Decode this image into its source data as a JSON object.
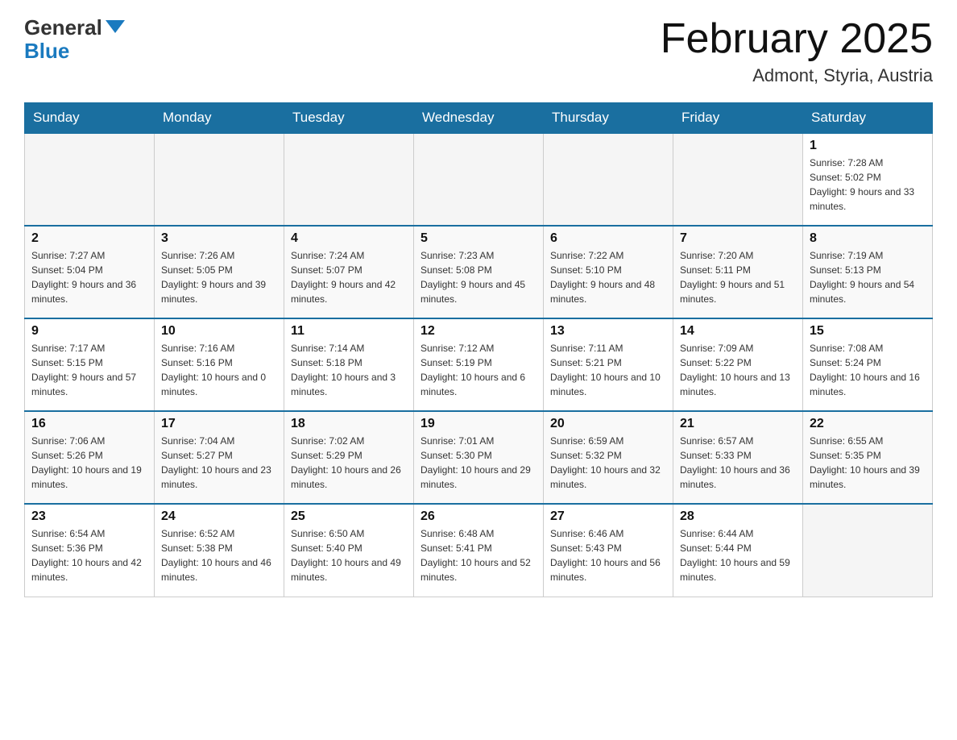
{
  "logo": {
    "text_general": "General",
    "text_blue": "Blue"
  },
  "header": {
    "title": "February 2025",
    "location": "Admont, Styria, Austria"
  },
  "days_of_week": [
    "Sunday",
    "Monday",
    "Tuesday",
    "Wednesday",
    "Thursday",
    "Friday",
    "Saturday"
  ],
  "weeks": [
    [
      {
        "day": "",
        "info": ""
      },
      {
        "day": "",
        "info": ""
      },
      {
        "day": "",
        "info": ""
      },
      {
        "day": "",
        "info": ""
      },
      {
        "day": "",
        "info": ""
      },
      {
        "day": "",
        "info": ""
      },
      {
        "day": "1",
        "info": "Sunrise: 7:28 AM\nSunset: 5:02 PM\nDaylight: 9 hours and 33 minutes."
      }
    ],
    [
      {
        "day": "2",
        "info": "Sunrise: 7:27 AM\nSunset: 5:04 PM\nDaylight: 9 hours and 36 minutes."
      },
      {
        "day": "3",
        "info": "Sunrise: 7:26 AM\nSunset: 5:05 PM\nDaylight: 9 hours and 39 minutes."
      },
      {
        "day": "4",
        "info": "Sunrise: 7:24 AM\nSunset: 5:07 PM\nDaylight: 9 hours and 42 minutes."
      },
      {
        "day": "5",
        "info": "Sunrise: 7:23 AM\nSunset: 5:08 PM\nDaylight: 9 hours and 45 minutes."
      },
      {
        "day": "6",
        "info": "Sunrise: 7:22 AM\nSunset: 5:10 PM\nDaylight: 9 hours and 48 minutes."
      },
      {
        "day": "7",
        "info": "Sunrise: 7:20 AM\nSunset: 5:11 PM\nDaylight: 9 hours and 51 minutes."
      },
      {
        "day": "8",
        "info": "Sunrise: 7:19 AM\nSunset: 5:13 PM\nDaylight: 9 hours and 54 minutes."
      }
    ],
    [
      {
        "day": "9",
        "info": "Sunrise: 7:17 AM\nSunset: 5:15 PM\nDaylight: 9 hours and 57 minutes."
      },
      {
        "day": "10",
        "info": "Sunrise: 7:16 AM\nSunset: 5:16 PM\nDaylight: 10 hours and 0 minutes."
      },
      {
        "day": "11",
        "info": "Sunrise: 7:14 AM\nSunset: 5:18 PM\nDaylight: 10 hours and 3 minutes."
      },
      {
        "day": "12",
        "info": "Sunrise: 7:12 AM\nSunset: 5:19 PM\nDaylight: 10 hours and 6 minutes."
      },
      {
        "day": "13",
        "info": "Sunrise: 7:11 AM\nSunset: 5:21 PM\nDaylight: 10 hours and 10 minutes."
      },
      {
        "day": "14",
        "info": "Sunrise: 7:09 AM\nSunset: 5:22 PM\nDaylight: 10 hours and 13 minutes."
      },
      {
        "day": "15",
        "info": "Sunrise: 7:08 AM\nSunset: 5:24 PM\nDaylight: 10 hours and 16 minutes."
      }
    ],
    [
      {
        "day": "16",
        "info": "Sunrise: 7:06 AM\nSunset: 5:26 PM\nDaylight: 10 hours and 19 minutes."
      },
      {
        "day": "17",
        "info": "Sunrise: 7:04 AM\nSunset: 5:27 PM\nDaylight: 10 hours and 23 minutes."
      },
      {
        "day": "18",
        "info": "Sunrise: 7:02 AM\nSunset: 5:29 PM\nDaylight: 10 hours and 26 minutes."
      },
      {
        "day": "19",
        "info": "Sunrise: 7:01 AM\nSunset: 5:30 PM\nDaylight: 10 hours and 29 minutes."
      },
      {
        "day": "20",
        "info": "Sunrise: 6:59 AM\nSunset: 5:32 PM\nDaylight: 10 hours and 32 minutes."
      },
      {
        "day": "21",
        "info": "Sunrise: 6:57 AM\nSunset: 5:33 PM\nDaylight: 10 hours and 36 minutes."
      },
      {
        "day": "22",
        "info": "Sunrise: 6:55 AM\nSunset: 5:35 PM\nDaylight: 10 hours and 39 minutes."
      }
    ],
    [
      {
        "day": "23",
        "info": "Sunrise: 6:54 AM\nSunset: 5:36 PM\nDaylight: 10 hours and 42 minutes."
      },
      {
        "day": "24",
        "info": "Sunrise: 6:52 AM\nSunset: 5:38 PM\nDaylight: 10 hours and 46 minutes."
      },
      {
        "day": "25",
        "info": "Sunrise: 6:50 AM\nSunset: 5:40 PM\nDaylight: 10 hours and 49 minutes."
      },
      {
        "day": "26",
        "info": "Sunrise: 6:48 AM\nSunset: 5:41 PM\nDaylight: 10 hours and 52 minutes."
      },
      {
        "day": "27",
        "info": "Sunrise: 6:46 AM\nSunset: 5:43 PM\nDaylight: 10 hours and 56 minutes."
      },
      {
        "day": "28",
        "info": "Sunrise: 6:44 AM\nSunset: 5:44 PM\nDaylight: 10 hours and 59 minutes."
      },
      {
        "day": "",
        "info": ""
      }
    ]
  ]
}
